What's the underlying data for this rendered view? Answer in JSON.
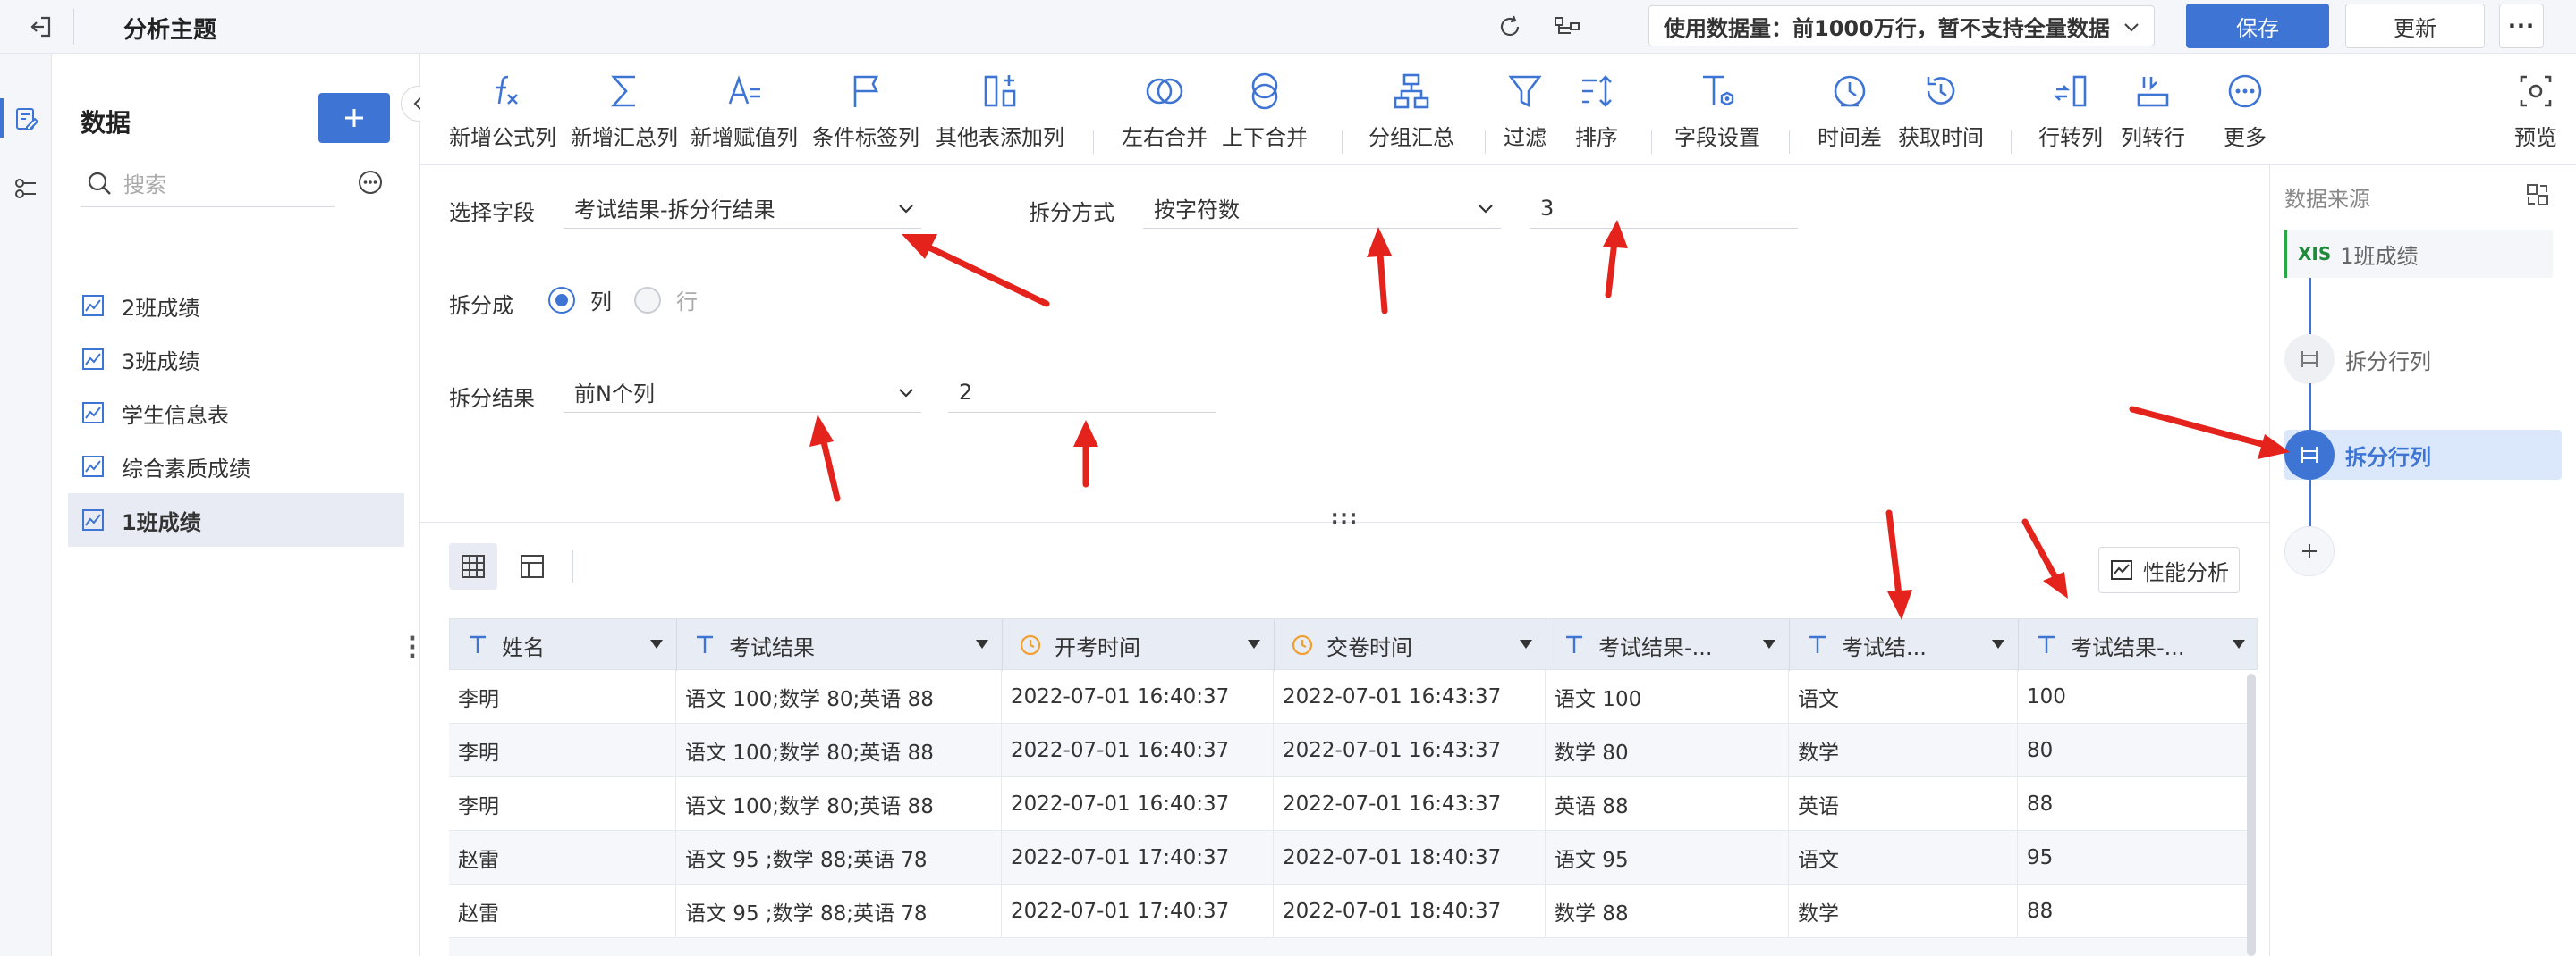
{
  "header": {
    "title": "分析主题",
    "data_usage": "使用数据量：前1000万行，暂不支持全量数据",
    "save_label": "保存",
    "update_label": "更新"
  },
  "sidebar": {
    "title": "数据",
    "search_placeholder": "搜索",
    "items": [
      {
        "label": "2班成绩"
      },
      {
        "label": "3班成绩"
      },
      {
        "label": "学生信息表"
      },
      {
        "label": "综合素质成绩"
      },
      {
        "label": "1班成绩"
      }
    ]
  },
  "toolbar": {
    "items": [
      {
        "label": "新增公式列",
        "icon": "formula-icon"
      },
      {
        "label": "新增汇总列",
        "icon": "sum-icon"
      },
      {
        "label": "新增赋值列",
        "icon": "assign-icon"
      },
      {
        "label": "条件标签列",
        "icon": "flag-icon"
      },
      {
        "label": "其他表添加列",
        "icon": "add-column-icon"
      },
      {
        "label": "左右合并",
        "icon": "merge-horizontal-icon"
      },
      {
        "label": "上下合并",
        "icon": "merge-vertical-icon"
      },
      {
        "label": "分组汇总",
        "icon": "group-icon"
      },
      {
        "label": "过滤",
        "icon": "filter-icon"
      },
      {
        "label": "排序",
        "icon": "sort-icon"
      },
      {
        "label": "字段设置",
        "icon": "field-settings-icon"
      },
      {
        "label": "时间差",
        "icon": "time-diff-icon"
      },
      {
        "label": "获取时间",
        "icon": "get-time-icon"
      },
      {
        "label": "行转列",
        "icon": "row-to-column-icon"
      },
      {
        "label": "列转行",
        "icon": "column-to-row-icon"
      },
      {
        "label": "更多",
        "icon": "more-icon"
      },
      {
        "label": "预览",
        "icon": "preview-icon"
      }
    ]
  },
  "form": {
    "field_label": "选择字段",
    "field_value": "考试结果-拆分行结果",
    "method_label": "拆分方式",
    "method_value": "按字符数",
    "method_count": "3",
    "split_into_label": "拆分成",
    "option_col": "列",
    "option_row": "行",
    "result_label": "拆分结果",
    "result_value": "前N个列",
    "result_count": "2"
  },
  "table": {
    "perf_label": "性能分析",
    "columns": [
      "姓名",
      "考试结果",
      "开考时间",
      "交卷时间",
      "考试结果-...",
      "考试结...",
      "考试结果-..."
    ],
    "rows": [
      [
        "李明",
        "语文 100;数学 80;英语 88",
        "2022-07-01 16:40:37",
        "2022-07-01 16:43:37",
        "语文 100",
        "语文",
        "100"
      ],
      [
        "李明",
        "语文 100;数学 80;英语 88",
        "2022-07-01 16:40:37",
        "2022-07-01 16:43:37",
        "数学 80",
        "数学",
        "80"
      ],
      [
        "李明",
        "语文 100;数学 80;英语 88",
        "2022-07-01 16:40:37",
        "2022-07-01 16:43:37",
        "英语 88",
        "英语",
        "88"
      ],
      [
        "赵雷",
        "语文 95 ;数学 88;英语 78",
        "2022-07-01 17:40:37",
        "2022-07-01 18:40:37",
        "语文 95",
        "语文",
        "95"
      ],
      [
        "赵雷",
        "语文 95 ;数学 88;英语 78",
        "2022-07-01 17:40:37",
        "2022-07-01 18:40:37",
        "数学 88",
        "数学",
        "88"
      ]
    ]
  },
  "flow": {
    "title": "数据来源",
    "source": "1班成绩",
    "step1": "拆分行列",
    "step2": "拆分行列"
  },
  "colors": {
    "primary": "#3e74d3",
    "annotation_red": "#e5231d",
    "header_bg": "#f4f6fa"
  }
}
